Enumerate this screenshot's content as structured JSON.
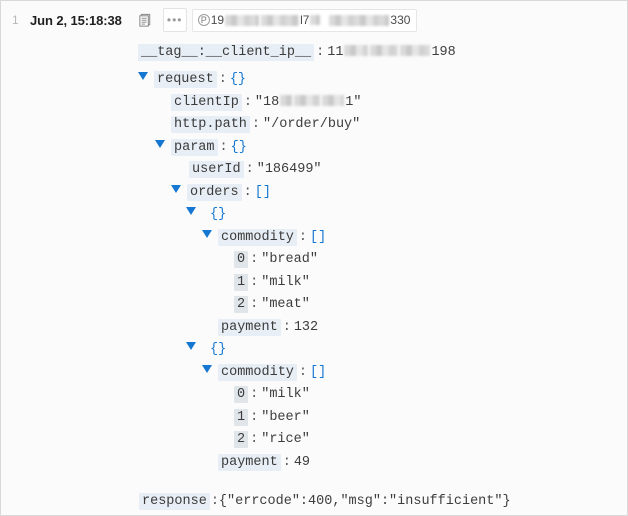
{
  "panel": {
    "row_number": "1",
    "timestamp": "Jun 2, 15:18:38"
  },
  "toolbar": {
    "copy_icon": "copy-document-icon",
    "more_icon": "more-options-icon",
    "chip_prefix_icon": "circled-p-icon",
    "chip_text_start": "19",
    "chip_text_mid": "l7",
    "chip_text_end": "330"
  },
  "tagline": {
    "key": "__tag__:__client_ip__",
    "colon": ":",
    "value_start": "11",
    "value_end": "198"
  },
  "tree": {
    "request": {
      "caret": "▼",
      "key": "request",
      "colon": ":",
      "brace": "{}"
    },
    "clientIp": {
      "key": "clientIp",
      "colon": ":",
      "value_start": "\"18",
      "value_end": "1\""
    },
    "httpPath": {
      "key": "http.path",
      "colon": ":",
      "value": "\"/order/buy\""
    },
    "param": {
      "caret": "▼",
      "key": "param",
      "colon": ":",
      "brace": "{}"
    },
    "userId": {
      "key": "userId",
      "colon": ":",
      "value": "\"186499\""
    },
    "orders": {
      "caret": "▼",
      "key": "orders",
      "colon": ":",
      "brace": "[]"
    },
    "order_items": [
      {
        "object_brace": "{}",
        "commodity_key": "commodity",
        "commodity_brace": "[]",
        "items": [
          {
            "index": "0",
            "value": "\"bread\""
          },
          {
            "index": "1",
            "value": "\"milk\""
          },
          {
            "index": "2",
            "value": "\"meat\""
          }
        ],
        "payment_key": "payment",
        "payment_value": "132"
      },
      {
        "object_brace": "{}",
        "commodity_key": "commodity",
        "commodity_brace": "[]",
        "items": [
          {
            "index": "0",
            "value": "\"milk\""
          },
          {
            "index": "1",
            "value": "\"beer\""
          },
          {
            "index": "2",
            "value": "\"rice\""
          }
        ],
        "payment_key": "payment",
        "payment_value": "49"
      }
    ]
  },
  "response": {
    "key": "response",
    "colon": ":",
    "value": "{\"errcode\":400,\"msg\":\"insufficient\"}"
  },
  "colors": {
    "accent_blue": "#1677d2",
    "key_bg": "#e8eef5",
    "panel_bg": "#fbfbfb",
    "border": "#d9d9d9",
    "text": "#3d3d3d",
    "muted": "#b8b8b8"
  }
}
